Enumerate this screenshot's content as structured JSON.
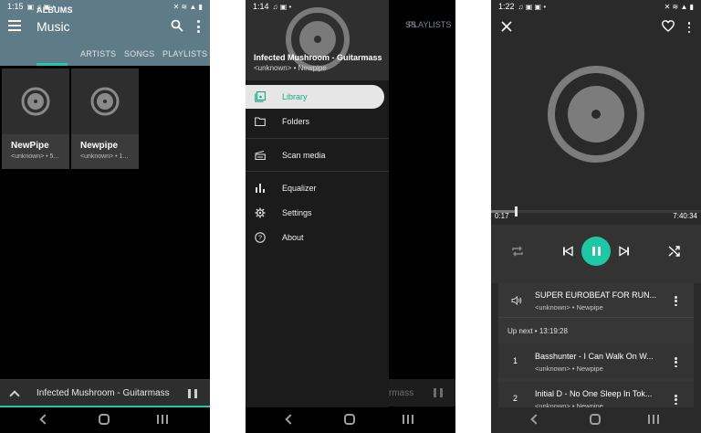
{
  "phone1": {
    "status": {
      "time": "1:15"
    },
    "appbar": {
      "title": "Music"
    },
    "tabs": [
      "ALBUMS",
      "ARTISTS",
      "SONGS",
      "PLAYLISTS"
    ],
    "albums": [
      {
        "name": "NewPipe",
        "sub": "<unknown> • 5..."
      },
      {
        "name": "Newpipe",
        "sub": "<unknown> • 1..."
      }
    ],
    "miniplayer": {
      "title": "Infected Mushroom - Guitarmass"
    }
  },
  "phone2": {
    "status": {
      "time": "1:14"
    },
    "behind": {
      "tab_fragment": "SS",
      "tab_playlists": "PLAYLISTS",
      "mini_fragment": "rmass"
    },
    "header": {
      "title": "Infected Mushroom - Guitarmass",
      "subtitle": "<unknown>  •  Newpipe"
    },
    "items": [
      {
        "label": "Library",
        "icon": "library-icon"
      },
      {
        "label": "Folders",
        "icon": "folder-icon"
      },
      {
        "label": "Scan media",
        "icon": "scan-media-icon"
      },
      {
        "label": "Equalizer",
        "icon": "equalizer-icon"
      },
      {
        "label": "Settings",
        "icon": "gear-icon"
      },
      {
        "label": "About",
        "icon": "help-icon"
      }
    ]
  },
  "phone3": {
    "status": {
      "time": "1:22"
    },
    "seek": {
      "elapsed": "0:17",
      "total": "7:40:34",
      "progress_fraction": 0.04
    },
    "current": {
      "title": "SUPER EUROBEAT FOR RUN...",
      "sub": "<unknown>  •  Newpipe"
    },
    "upnext": "Up next  •  13:19:28",
    "queue": [
      {
        "num": "1",
        "title": "Basshunter - I Can Walk On W...",
        "sub": "<unknown>  •  Newpipe"
      },
      {
        "num": "2",
        "title": "Initial D - No One Sleep In Tok...",
        "sub": "<unknown>  •  Newpipe"
      }
    ]
  },
  "colors": {
    "accent": "#1ec8a4",
    "appbar": "#5f7b87"
  }
}
